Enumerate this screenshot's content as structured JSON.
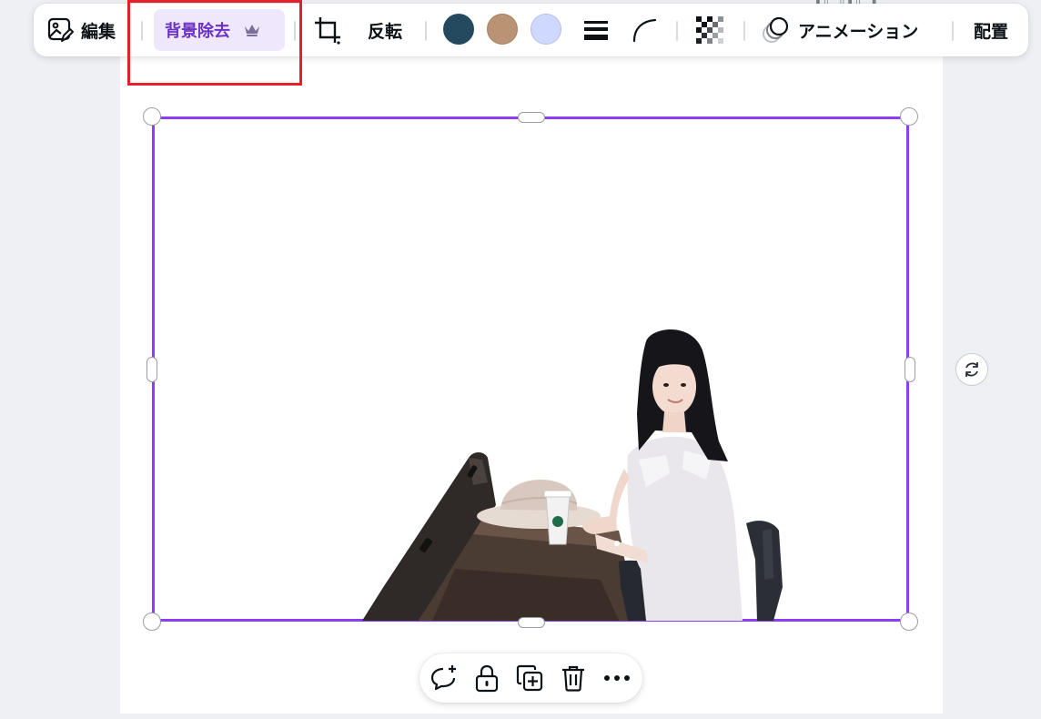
{
  "toolbar": {
    "edit_label": "編集",
    "bg_remove_label": "背景除去",
    "flip_label": "反転",
    "animation_label": "アニメーション",
    "position_label": "配置",
    "colors": [
      "#234a5e",
      "#b99373",
      "#cfd8ff"
    ]
  },
  "icons": {
    "edit": "image-edit-icon",
    "premium": "crown-icon",
    "crop": "crop-icon",
    "border_style": "border-style-icon",
    "corner": "corner-rounding-icon",
    "transparency": "transparency-icon",
    "animation": "animation-icon",
    "rotate": "rotate-icon",
    "comment": "add-comment-icon",
    "lock": "lock-icon",
    "duplicate": "duplicate-icon",
    "delete": "trash-icon",
    "more": "more-icon"
  },
  "theme": {
    "accent": "#8b3ef5",
    "highlight": "#e3202c",
    "bg_remove_bg": "#efe7fc",
    "bg_remove_text": "#6b32c6"
  }
}
